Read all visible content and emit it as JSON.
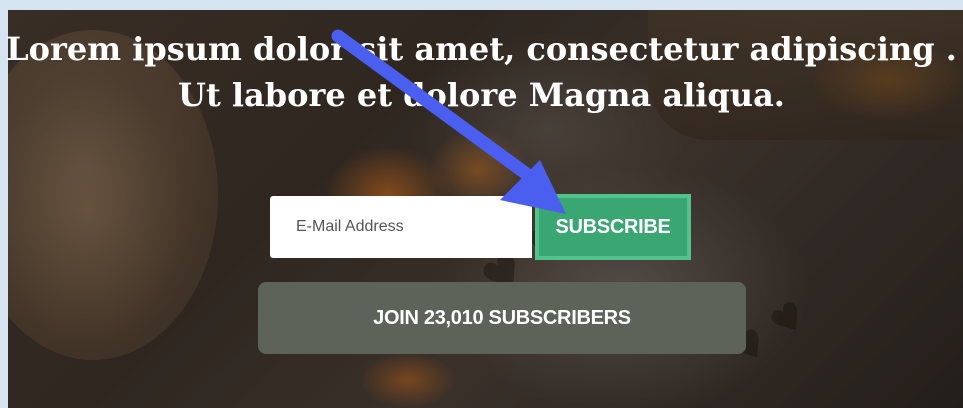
{
  "headline": {
    "line1": "Lorem ipsum dolor sit amet, consectetur adipiscing .",
    "line2": "Ut labore et dolore Magna aliqua."
  },
  "signup": {
    "email_placeholder": "E-Mail Address",
    "email_value": "",
    "subscribe_label": "SUBSCRIBE",
    "join_label": "JOIN 23,010 SUBSCRIBERS"
  },
  "colors": {
    "subscribe_fill": "#3aa672",
    "subscribe_border": "#52c48b",
    "join_fill": "#5d6359",
    "annotation_arrow": "#4a5ff0"
  },
  "icons": {
    "annotation": "arrow-pointer-icon"
  }
}
